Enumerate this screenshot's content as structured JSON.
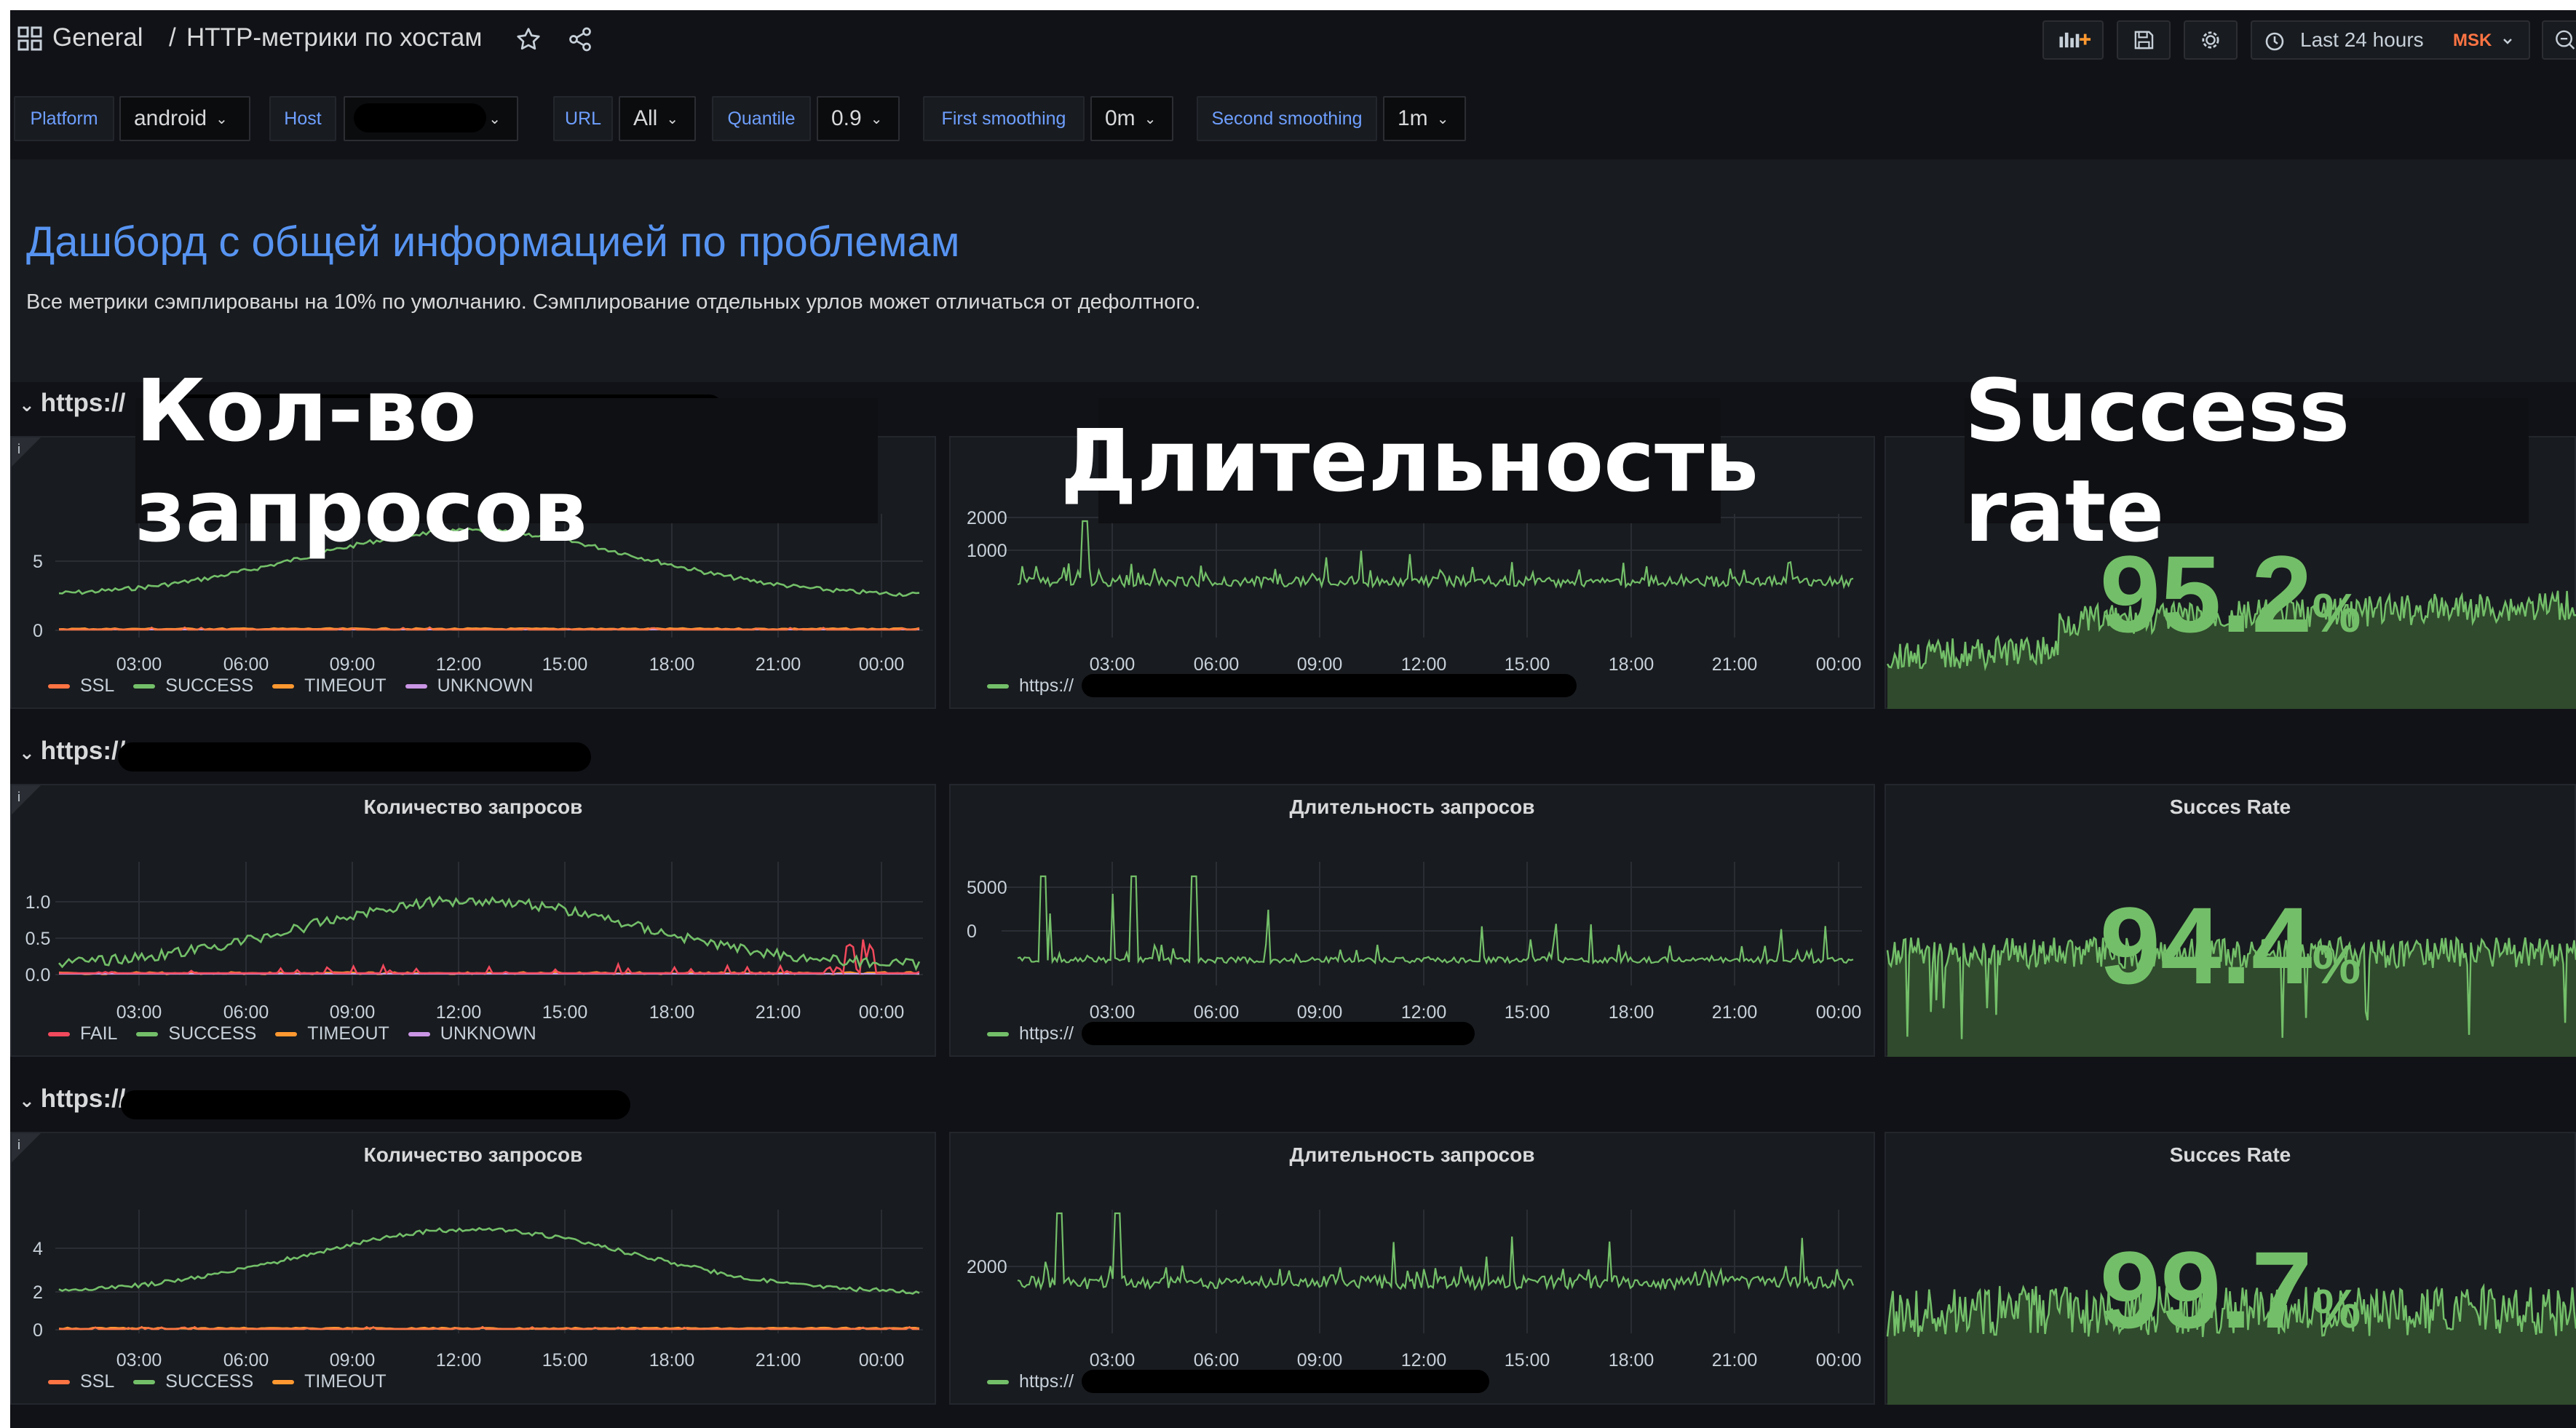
{
  "breadcrumb": {
    "folder": "General",
    "separator": "/",
    "title": "HTTP-метрики по хостам"
  },
  "time_picker": {
    "label": "Last 24 hours",
    "timezone": "MSK"
  },
  "variables": [
    {
      "label": "Platform",
      "value": "android"
    },
    {
      "label": "Host",
      "value": ""
    },
    {
      "label": "URL",
      "value": "All"
    },
    {
      "label": "Quantile",
      "value": "0.9"
    },
    {
      "label": "First smoothing",
      "value": "0m"
    },
    {
      "label": "Second smoothing",
      "value": "1m"
    }
  ],
  "text_panel": {
    "title": "Дашборд с общей информацией по проблемам",
    "description": "Все метрики сэмплированы на 10% по умолчанию. Сэмплирование отдельных урлов может отличаться от дефолтного."
  },
  "overlays": {
    "count": "Кол-во запросов",
    "duration": "Длительность",
    "success": "Success rate"
  },
  "rows": [
    {
      "title": "https://",
      "count_panel": {
        "title": "",
        "y_ticks": [
          "5",
          "0"
        ],
        "legend": [
          "SSL",
          "SUCCESS",
          "TIMEOUT",
          "UNKNOWN"
        ]
      },
      "duration_panel": {
        "title": "",
        "y_ticks": [
          "2000",
          "1000"
        ],
        "legend": [
          "https://"
        ]
      },
      "success_panel": {
        "title": "",
        "value": "95.2",
        "unit": "%"
      }
    },
    {
      "title": "https://",
      "count_panel": {
        "title": "Количество запросов",
        "y_ticks": [
          "1.0",
          "0.5",
          "0.0"
        ],
        "legend": [
          "FAIL",
          "SUCCESS",
          "TIMEOUT",
          "UNKNOWN"
        ]
      },
      "duration_panel": {
        "title": "Длительность запросов",
        "y_ticks": [
          "5000",
          "0"
        ],
        "legend": [
          "https://"
        ]
      },
      "success_panel": {
        "title": "Succes Rate",
        "value": "94.4",
        "unit": "%"
      }
    },
    {
      "title": "https://",
      "count_panel": {
        "title": "Количество запросов",
        "y_ticks": [
          "4",
          "2",
          "0"
        ],
        "legend": [
          "SSL",
          "SUCCESS",
          "TIMEOUT"
        ]
      },
      "duration_panel": {
        "title": "Длительность запросов",
        "y_ticks": [
          "2000"
        ],
        "legend": [
          "https://"
        ]
      },
      "success_panel": {
        "title": "Succes Rate",
        "value": "99.7",
        "unit": "%"
      }
    }
  ],
  "x_ticks": [
    "03:00",
    "06:00",
    "09:00",
    "12:00",
    "15:00",
    "18:00",
    "21:00",
    "00:00"
  ],
  "colors": {
    "ssl": "#ff7443",
    "fail": "#f2495c",
    "success": "#73bf69",
    "timeout": "#ff9830",
    "unknown": "#ca95e5",
    "link": "#6e9fff",
    "title": "#5794f2",
    "stat": "#73bf69"
  },
  "icons": {
    "apps": "apps-grid-icon",
    "star": "star-icon",
    "share": "share-icon",
    "add_panel": "add-panel-icon",
    "save": "save-icon",
    "settings": "gear-icon",
    "clock": "clock-icon",
    "zoom": "zoom-out-icon"
  }
}
